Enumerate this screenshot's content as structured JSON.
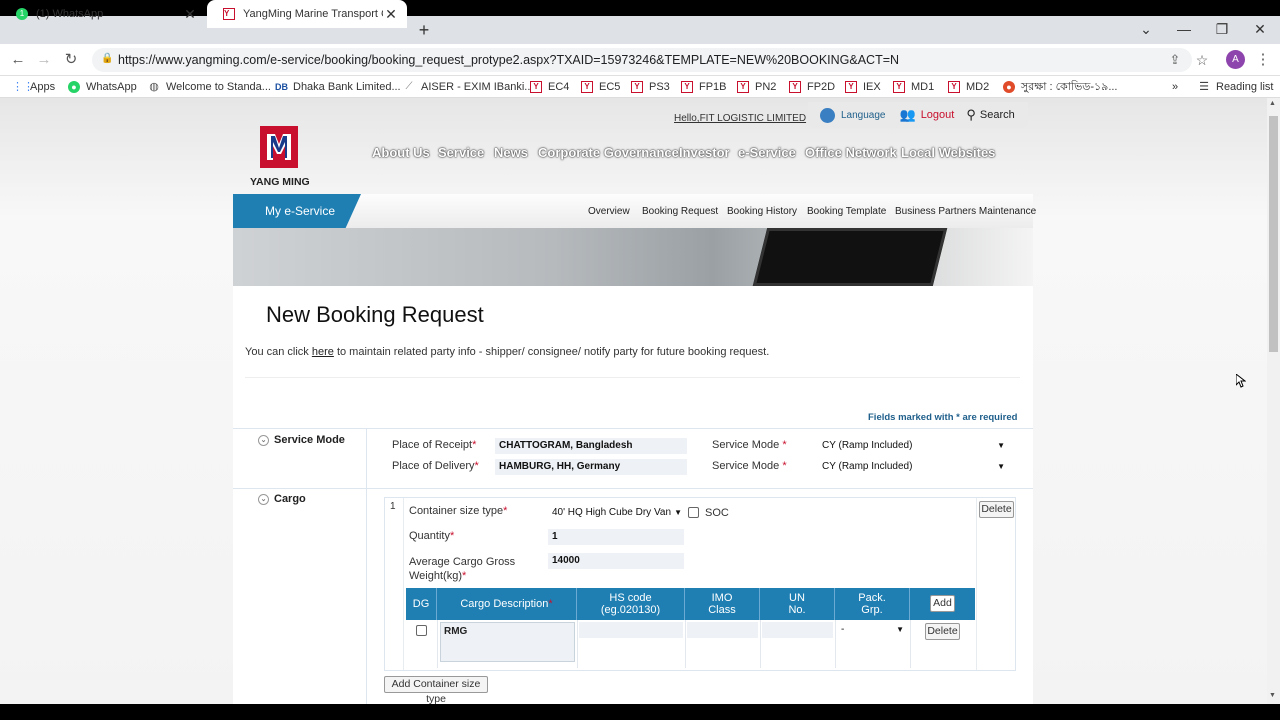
{
  "browser": {
    "tabs": [
      {
        "title": "(1) WhatsApp",
        "active": false
      },
      {
        "title": "YangMing Marine Transport Corp",
        "active": true
      }
    ],
    "url": "https://www.yangming.com/e-service/booking/booking_request_protype2.aspx?TXAID=15973246&TEMPLATE=NEW%20BOOKING&ACT=N",
    "profile_initial": "A",
    "bookmarks": [
      "Apps",
      "WhatsApp",
      "Welcome to Standa...",
      "Dhaka Bank Limited...",
      "AISER - EXIM IBanki...",
      "EC4",
      "EC5",
      "PS3",
      "FP1B",
      "PN2",
      "FP2D",
      "IEX",
      "MD1",
      "MD2",
      "সুরক্ষা : কোভিড-১৯..."
    ],
    "reading_list": "Reading list",
    "more_bookmarks": "»"
  },
  "header": {
    "greeting": "Hello,FIT LOGISTIC LIMITED",
    "language": "Language",
    "logout": "Logout",
    "search": "Search",
    "logo_text": "YANG MING",
    "main_nav": [
      "About Us",
      "Service",
      "News",
      "Corporate Governance",
      "Investor",
      "e-Service",
      "Office Network",
      "Local Websites"
    ]
  },
  "eservice": {
    "title": "My e-Service",
    "subnav": [
      "Overview",
      "Booking Request",
      "Booking History",
      "Booking Template",
      "Business Partners Maintenance"
    ]
  },
  "page": {
    "title": "New Booking Request",
    "info_prefix": "You can click ",
    "info_link": "here",
    "info_suffix": " to maintain related party info - shipper/ consignee/ notify party for future booking request.",
    "required_note": "Fields marked with * are required"
  },
  "service_mode": {
    "section_title": "Service Mode",
    "place_of_receipt_label": "Place of Receipt",
    "place_of_receipt": "CHATTOGRAM, Bangladesh",
    "place_of_delivery_label": "Place of Delivery",
    "place_of_delivery": "HAMBURG, HH, Germany",
    "service_mode_label": "Service Mode",
    "receipt_mode": "CY (Ramp Included)",
    "delivery_mode": "CY (Ramp Included)"
  },
  "cargo": {
    "section_title": "Cargo",
    "row_number": "1",
    "container_size_label": "Container size type",
    "container_size": "40' HQ High Cube Dry Van",
    "soc_label": "SOC",
    "quantity_label": "Quantity",
    "quantity": "1",
    "weight_label_1": "Average Cargo Gross",
    "weight_label_2": "Weight(kg)",
    "weight": "14000",
    "delete_label": "Delete",
    "table_headers": {
      "dg": "DG",
      "desc": "Cargo Description",
      "hs_1": "HS code",
      "hs_2": "(eg.020130)",
      "imo_1": "IMO",
      "imo_2": "Class",
      "un_1": "UN",
      "un_2": "No.",
      "pack_1": "Pack.",
      "pack_2": "Grp.",
      "add": "Add"
    },
    "row_desc": "RMG",
    "row_pack": "-",
    "row_delete": "Delete",
    "add_container_button": "Add Container size type"
  },
  "colors": {
    "brand_red": "#c8102e",
    "eservice_blue": "#1f7fb3"
  }
}
